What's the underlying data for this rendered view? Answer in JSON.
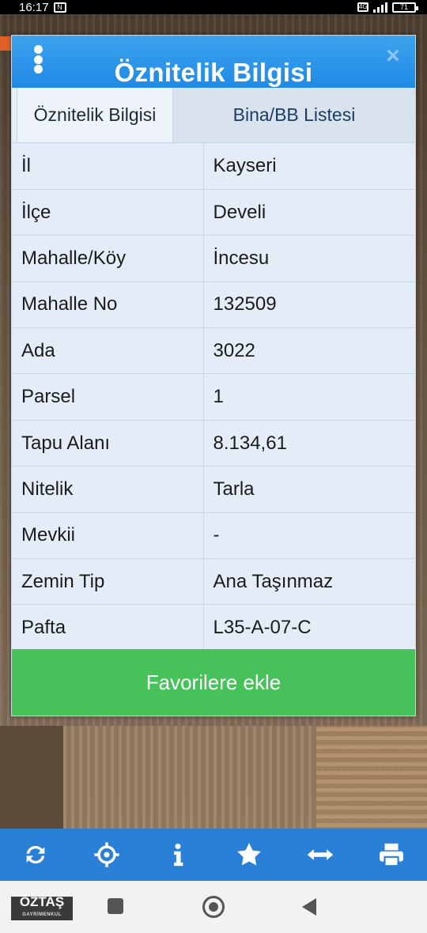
{
  "status_bar": {
    "time": "16:17",
    "battery": "71"
  },
  "dialog": {
    "title": "Öznitelik Bilgisi",
    "close_label": "×",
    "tabs": [
      {
        "label": "Öznitelik Bilgisi",
        "active": true
      },
      {
        "label": "Bina/BB Listesi",
        "active": false
      }
    ],
    "rows": [
      {
        "key": "İl",
        "value": "Kayseri"
      },
      {
        "key": "İlçe",
        "value": "Develi"
      },
      {
        "key": "Mahalle/Köy",
        "value": "İncesu"
      },
      {
        "key": "Mahalle No",
        "value": "132509"
      },
      {
        "key": "Ada",
        "value": "3022"
      },
      {
        "key": "Parsel",
        "value": "1"
      },
      {
        "key": "Tapu Alanı",
        "value": "8.134,61"
      },
      {
        "key": "Nitelik",
        "value": "Tarla"
      },
      {
        "key": "Mevkii",
        "value": "-"
      },
      {
        "key": "Zemin Tip",
        "value": "Ana Taşınmaz"
      },
      {
        "key": "Pafta",
        "value": "L35-A-07-C"
      }
    ],
    "favorite_button": "Favorilere ekle"
  },
  "toolbar": {
    "icons": [
      "refresh-icon",
      "locate-icon",
      "info-icon",
      "star-icon",
      "measure-icon",
      "print-icon"
    ]
  },
  "brand": {
    "name": "ÖZTAŞ",
    "tagline": "GAYRİMENKUL"
  },
  "colors": {
    "header_blue": "#2a8fe8",
    "toolbar_blue": "#2a7fd6",
    "favorite_green": "#47c25a"
  }
}
